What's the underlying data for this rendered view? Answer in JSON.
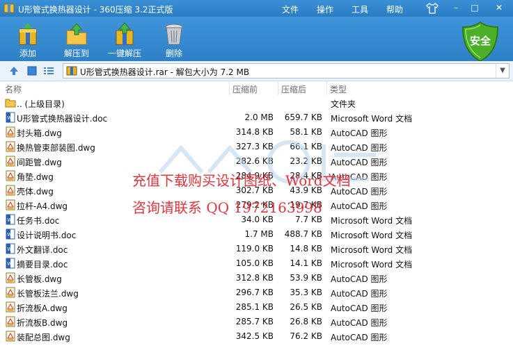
{
  "window": {
    "title": "U形管式换热器设计 - 360压缩 3.2正式版"
  },
  "menu": {
    "file": "文件",
    "operate": "操作",
    "tools": "工具",
    "help": "帮助"
  },
  "winbtns": {
    "min": "–",
    "max": "□",
    "close": "✕"
  },
  "toolbar": {
    "add": "添加",
    "extract_to": "解压到",
    "one_click": "一键解压",
    "delete": "删除"
  },
  "security": {
    "label": "安全"
  },
  "path": {
    "text": "U形管式换热器设计.rar - 解包大小为 7.2 MB"
  },
  "columns": {
    "name": "名称",
    "size": "压缩前",
    "packed": "压缩后",
    "type": "类型"
  },
  "parent": {
    "name": ".. (上级目录)",
    "type": "文件夹"
  },
  "files": [
    {
      "name": "U形管式换热器设计.doc",
      "size": "2.0 MB",
      "packed": "659.7 KB",
      "type": "Microsoft Word 文档",
      "icon": "word-icon"
    },
    {
      "name": "封头箱.dwg",
      "size": "314.8 KB",
      "packed": "58.1 KB",
      "type": "AutoCAD 图形",
      "icon": "dwg-icon"
    },
    {
      "name": "换热管束部装图.dwg",
      "size": "327.3 KB",
      "packed": "66.1 KB",
      "type": "AutoCAD 图形",
      "icon": "dwg-icon"
    },
    {
      "name": "间距管.dwg",
      "size": "282.6 KB",
      "packed": "23.2 KB",
      "type": "AutoCAD 图形",
      "icon": "dwg-icon"
    },
    {
      "name": "角垫.dwg",
      "size": "284.9 KB",
      "packed": "28.4 KB",
      "type": "AutoCAD 图形",
      "icon": "dwg-icon"
    },
    {
      "name": "壳体.dwg",
      "size": "302.7 KB",
      "packed": "43.9 KB",
      "type": "AutoCAD 图形",
      "icon": "dwg-icon"
    },
    {
      "name": "拉杆-A4.dwg",
      "size": "279.2 KB",
      "packed": "19.7 KB",
      "type": "AutoCAD 图形",
      "icon": "dwg-icon"
    },
    {
      "name": "任务书.doc",
      "size": "34.0 KB",
      "packed": "7.7 KB",
      "type": "Microsoft Word 文档",
      "icon": "word-icon"
    },
    {
      "name": "设计说明书.doc",
      "size": "1.7 MB",
      "packed": "488.7 KB",
      "type": "Microsoft Word 文档",
      "icon": "word-icon"
    },
    {
      "name": "外文翻译.doc",
      "size": "119.0 KB",
      "packed": "14.8 KB",
      "type": "Microsoft Word 文档",
      "icon": "word-icon"
    },
    {
      "name": "摘要目录.doc",
      "size": "105.0 KB",
      "packed": "14.1 KB",
      "type": "Microsoft Word 文档",
      "icon": "word-icon"
    },
    {
      "name": "长管板.dwg",
      "size": "312.8 KB",
      "packed": "53.9 KB",
      "type": "AutoCAD 图形",
      "icon": "dwg-icon"
    },
    {
      "name": "长管板法兰.dwg",
      "size": "296.7 KB",
      "packed": "35.3 KB",
      "type": "AutoCAD 图形",
      "icon": "dwg-icon"
    },
    {
      "name": "折流板A.dwg",
      "size": "285.1 KB",
      "packed": "26.5 KB",
      "type": "AutoCAD 图形",
      "icon": "dwg-icon"
    },
    {
      "name": "折流板B.dwg",
      "size": "285.7 KB",
      "packed": "26.8 KB",
      "type": "AutoCAD 图形",
      "icon": "dwg-icon"
    },
    {
      "name": "装配总图.dwg",
      "size": "342.5 KB",
      "packed": "76.2 KB",
      "type": "AutoCAD 图形",
      "icon": "dwg-icon"
    }
  ],
  "watermark": {
    "line1": "充值下载购买设计图纸、Word文档",
    "line2": "咨询请联系  QQ  1972163998"
  },
  "colors": {
    "accent": "#2f80c7",
    "watermark": "#e8323a",
    "shield": "#4caf2a"
  }
}
